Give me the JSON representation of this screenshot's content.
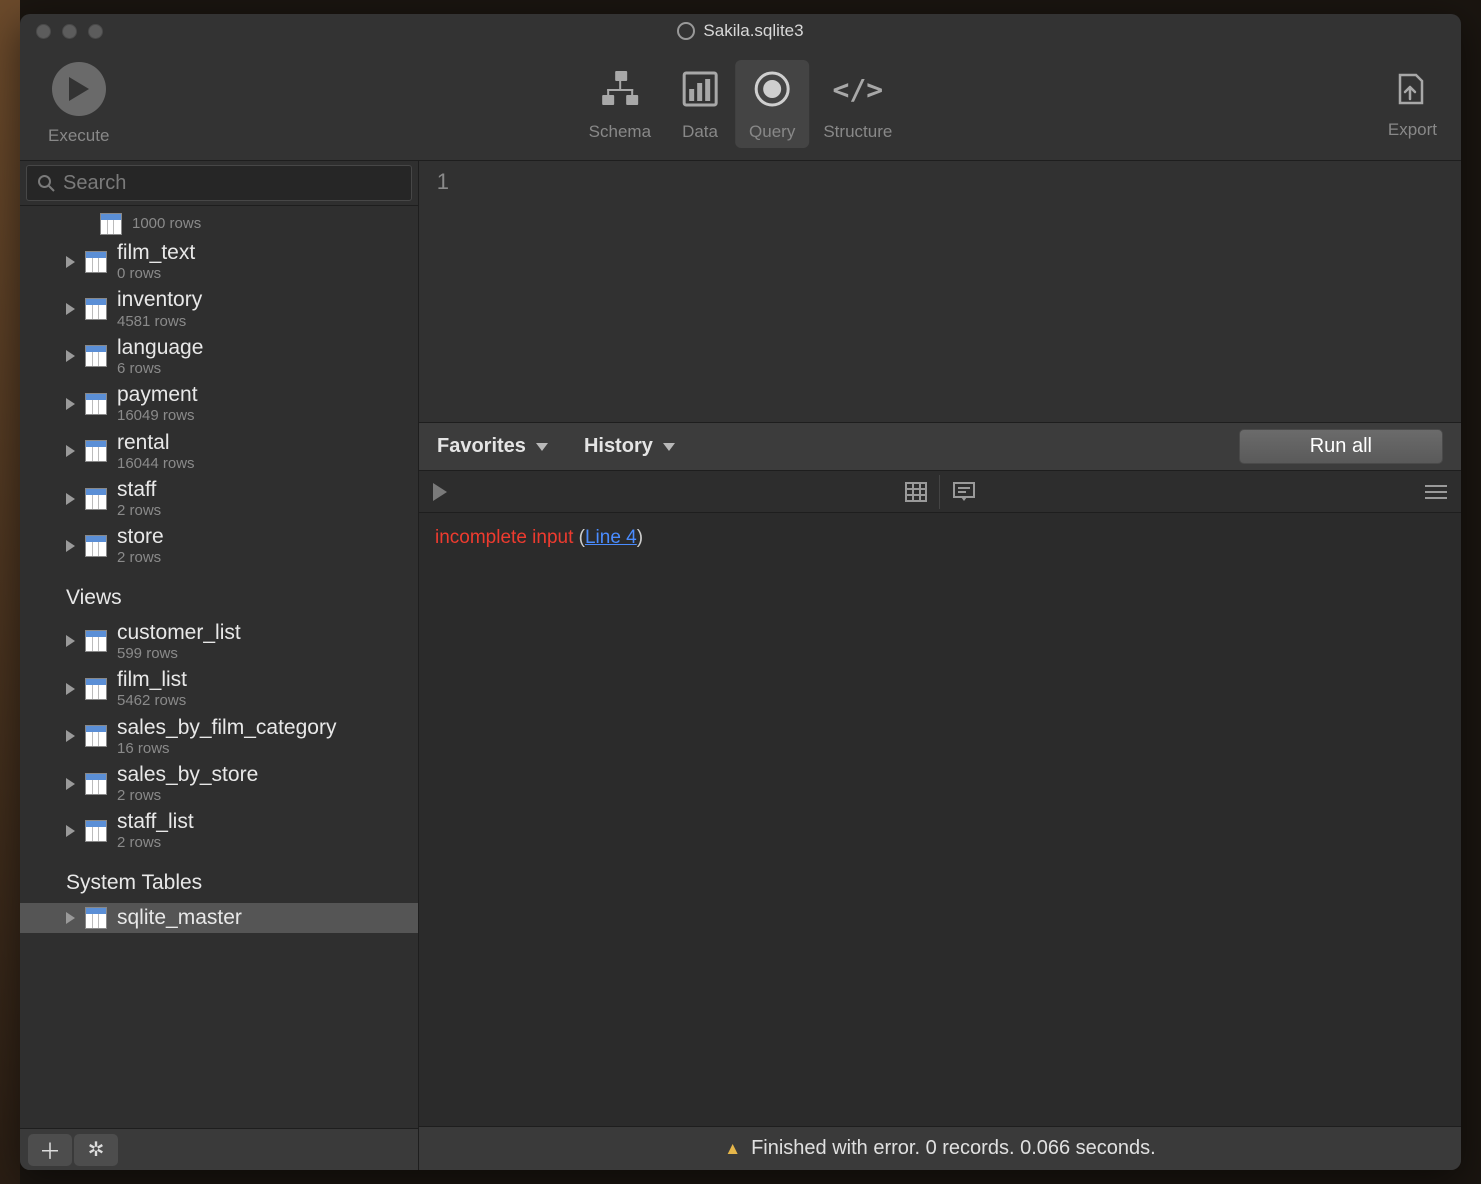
{
  "window": {
    "title": "Sakila.sqlite3"
  },
  "toolbar": {
    "execute_label": "Execute",
    "schema_label": "Schema",
    "data_label": "Data",
    "query_label": "Query",
    "structure_label": "Structure",
    "export_label": "Export"
  },
  "search": {
    "placeholder": "Search"
  },
  "sidebar": {
    "partial_row": {
      "sub": "1000 rows"
    },
    "tables": [
      {
        "name": "film_text",
        "sub": "0 rows"
      },
      {
        "name": "inventory",
        "sub": "4581 rows"
      },
      {
        "name": "language",
        "sub": "6 rows"
      },
      {
        "name": "payment",
        "sub": "16049 rows"
      },
      {
        "name": "rental",
        "sub": "16044 rows"
      },
      {
        "name": "staff",
        "sub": "2 rows"
      },
      {
        "name": "store",
        "sub": "2 rows"
      }
    ],
    "views_header": "Views",
    "views": [
      {
        "name": "customer_list",
        "sub": "599 rows"
      },
      {
        "name": "film_list",
        "sub": "5462 rows"
      },
      {
        "name": "sales_by_film_category",
        "sub": "16 rows"
      },
      {
        "name": "sales_by_store",
        "sub": "2 rows"
      },
      {
        "name": "staff_list",
        "sub": "2 rows"
      }
    ],
    "system_header": "System Tables",
    "system": [
      {
        "name": "sqlite_master"
      }
    ]
  },
  "editor": {
    "line_number": "1"
  },
  "midbar": {
    "favorites": "Favorites",
    "history": "History",
    "run_all": "Run all"
  },
  "error": {
    "message": "incomplete input",
    "line_link": "Line 4"
  },
  "status": {
    "text": "Finished with error. 0 records. 0.066 seconds."
  }
}
